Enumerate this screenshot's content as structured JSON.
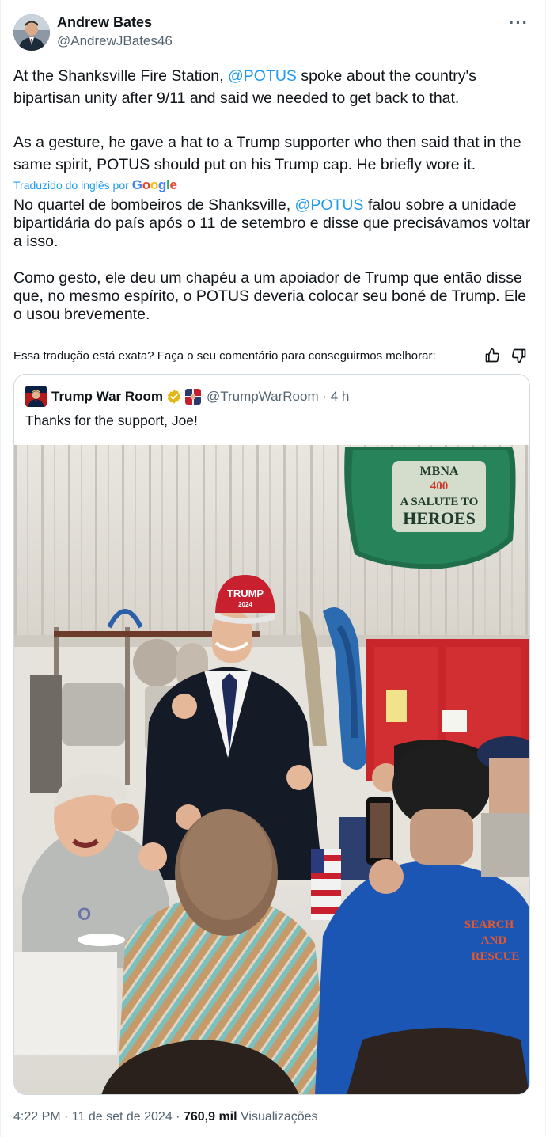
{
  "author": {
    "name": "Andrew Bates",
    "handle": "@AndrewJBates46"
  },
  "tweet": {
    "text_line1_pre": "At the Shanksville Fire Station, ",
    "text_line1_mention": "@POTUS",
    "text_line1_post": " spoke about the country's bipartisan unity after 9/11 and said we needed to get back to that.",
    "text_para2": "As a gesture, he gave a hat to a Trump supporter who then said that in the  same spirit, POTUS should put on his Trump cap. He briefly wore it."
  },
  "translation": {
    "label": "Traduzido do inglês por",
    "provider": [
      "G",
      "o",
      "o",
      "g",
      "l",
      "e"
    ],
    "para1_pre": "No quartel de bombeiros de Shanksville, ",
    "para1_mention": "@POTUS",
    "para1_post": " falou sobre a unidade bipartidária do país após o 11 de setembro e disse que precisávamos voltar a isso.",
    "para2": "Como gesto, ele deu um chapéu a um apoiador de Trump que então disse que, no mesmo espírito, o POTUS deveria colocar seu boné de Trump. Ele o usou brevemente."
  },
  "feedback": {
    "question": "Essa tradução está exata? Faça o seu comentário para conseguirmos melhorar:"
  },
  "quoted": {
    "name": "Trump War Room",
    "handle_time": "@TrumpWarRoom · 4 h",
    "text": "Thanks for the support, Joe!",
    "photo": {
      "banner_line1": "MBNA",
      "banner_line2": "400",
      "banner_line3": "A SALUTE TO",
      "banner_line4": "HEROES",
      "cap_line1": "TRUMP",
      "cap_line2": "2024",
      "shirt_line1": "SEARCH",
      "shirt_line2": "AND",
      "shirt_line3": "RESCUE"
    }
  },
  "meta": {
    "time_date": "4:22 PM · 11 de set de 2024 · ",
    "views_count": "760,9 mil",
    "views_label": " Visualizações"
  },
  "colors": {
    "link": "#1d9bf0",
    "text": "#0f1419",
    "secondary": "#536471",
    "border": "#cfd9de"
  }
}
